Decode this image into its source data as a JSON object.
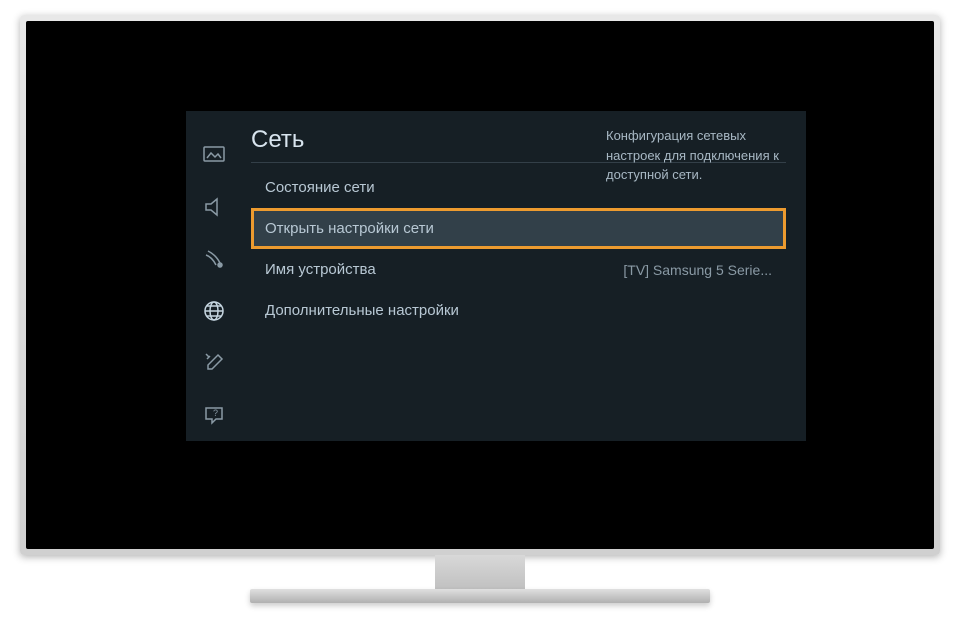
{
  "section": {
    "title": "Сеть"
  },
  "menu": {
    "items": [
      {
        "label": "Состояние сети",
        "value": ""
      },
      {
        "label": "Открыть настройки сети",
        "value": ""
      },
      {
        "label": "Имя устройства",
        "value": "[TV] Samsung 5 Serie..."
      },
      {
        "label": "Дополнительные настройки",
        "value": ""
      }
    ]
  },
  "help": {
    "text": "Конфигурация сетевых настроек для подключения к доступной сети."
  },
  "sidebar": {
    "icons": [
      "picture-icon",
      "sound-icon",
      "broadcast-icon",
      "network-icon",
      "system-icon",
      "support-icon"
    ]
  }
}
